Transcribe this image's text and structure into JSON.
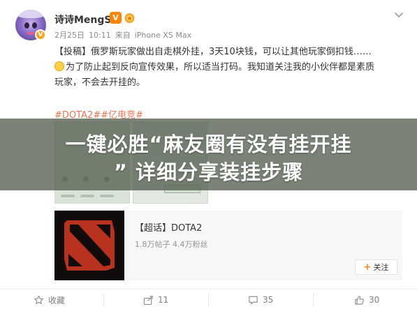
{
  "post": {
    "username": "诗诗MengS",
    "vip_label": "V",
    "meta": {
      "date": "2月25日",
      "time": "10:11",
      "source_prefix": "来自",
      "device": "iPhone XS Max"
    },
    "lines": [
      "【投稿】俄罗斯玩家做出自走棋外挂，3天10块钱，可以让其他玩家倒扣钱……",
      "为了防止起到反向宣传效果，所以适当打码。我知道关注我的小伙伴都是素质",
      "玩家，不会去开挂的。"
    ],
    "hashtags": "#DOTA2##亿电竞#"
  },
  "banner": {
    "line1": "一键必胜“麻友圈有没有挂开挂",
    "line2": "” 详细分享装挂步骤"
  },
  "topic_card": {
    "title": "【超话】DOTA2",
    "stats": "1.8万帖子 4.4万粉丝",
    "follow_label": "关注"
  },
  "actions": {
    "favorite": "收藏",
    "share": "11",
    "comment": "35",
    "like": "30"
  },
  "icons": {
    "chevron": "chevron-down-icon",
    "medal": "medal-icon",
    "favorite": "star-icon",
    "share": "share-icon",
    "comment": "comment-icon",
    "like": "thumbs-up-icon"
  },
  "colors": {
    "accent_orange": "#ff8200",
    "hashtag": "#eb7350",
    "banner_overlay": "#546050"
  }
}
